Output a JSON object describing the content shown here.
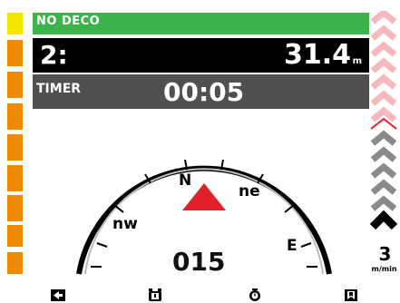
{
  "status": {
    "label": "NO DECO",
    "color": "#3eb34b"
  },
  "depth": {
    "gas_label": "2:",
    "value": "31.4",
    "unit": "m"
  },
  "timer": {
    "label": "TIMER",
    "value": "00:05"
  },
  "compass": {
    "heading": "015",
    "labels": {
      "north": "N",
      "northeast": "ne",
      "east": "E",
      "northwest": "nw"
    }
  },
  "ascent_rate": {
    "value": "3",
    "unit": "m/min"
  },
  "tissue_bar": {
    "colors": [
      "#f2e600",
      "#f08a00",
      "#f08a00",
      "#f08a00",
      "#f08a00",
      "#f08a00",
      "#f08a00",
      "#f08a00",
      "#f08a00"
    ]
  },
  "bottom_buttons": [
    {
      "icon": "left-arrow-icon"
    },
    {
      "icon": "alarm-clock-icon"
    },
    {
      "icon": "stopwatch-icon"
    },
    {
      "icon": "bookmark-icon"
    }
  ],
  "colors": {
    "accent_red": "#e0202a",
    "chevron_pink": "#f7b8bd",
    "chevron_grey": "#8a8a8a",
    "chevron_black": "#000000"
  }
}
